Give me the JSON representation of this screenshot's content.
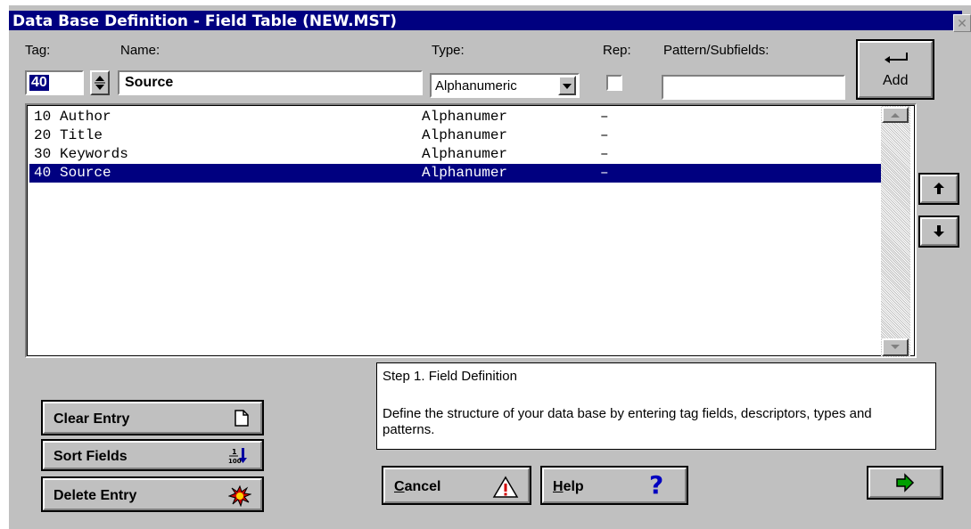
{
  "window": {
    "title": "Data Base Definition - Field Table (NEW.MST)",
    "close_glyph": "✕"
  },
  "form": {
    "tag_label": "Tag:",
    "name_label": "Name:",
    "type_label": "Type:",
    "rep_label": "Rep:",
    "pattern_label": "Pattern/Subfields:",
    "tag_value": "40",
    "name_value": "Source",
    "type_value": "Alphanumeric",
    "rep_checked": false,
    "pattern_value": ""
  },
  "add_button": {
    "icon": "enter-arrow-icon",
    "label": "Add"
  },
  "fields": [
    {
      "tag": "10",
      "name": "Author",
      "type": "Alphanumer",
      "pattern": "–"
    },
    {
      "tag": "20",
      "name": "Title",
      "type": "Alphanumer",
      "pattern": "–"
    },
    {
      "tag": "30",
      "name": "Keywords",
      "type": "Alphanumer",
      "pattern": "–"
    },
    {
      "tag": "40",
      "name": "Source",
      "type": "Alphanumer",
      "pattern": "–",
      "selected": true
    }
  ],
  "step_panel": {
    "heading": "Step 1. Field Definition",
    "text": "Define the structure of your data base by entering tag fields, descriptors, types and patterns."
  },
  "buttons": {
    "clear": {
      "label": "Clear Entry",
      "icon": "blank-page-icon"
    },
    "sort": {
      "label": "Sort Fields",
      "icon": "sort-numeric-icon",
      "icon_text": "1 100"
    },
    "delete": {
      "label": "Delete Entry",
      "icon": "explosion-icon"
    },
    "cancel": {
      "label_u": "C",
      "label_rest": "ancel",
      "icon": "warning-icon"
    },
    "help": {
      "label_u": "H",
      "label_rest": "elp",
      "icon": "question-icon",
      "icon_glyph": "?"
    },
    "next": {
      "icon": "right-arrow-icon"
    },
    "move_up": {
      "icon": "up-arrow-icon"
    },
    "move_down": {
      "icon": "down-arrow-icon"
    }
  },
  "colors": {
    "title_bar": "#000080",
    "selection": "#000080",
    "face": "#c0c0c0",
    "next_arrow": "#00a000"
  }
}
